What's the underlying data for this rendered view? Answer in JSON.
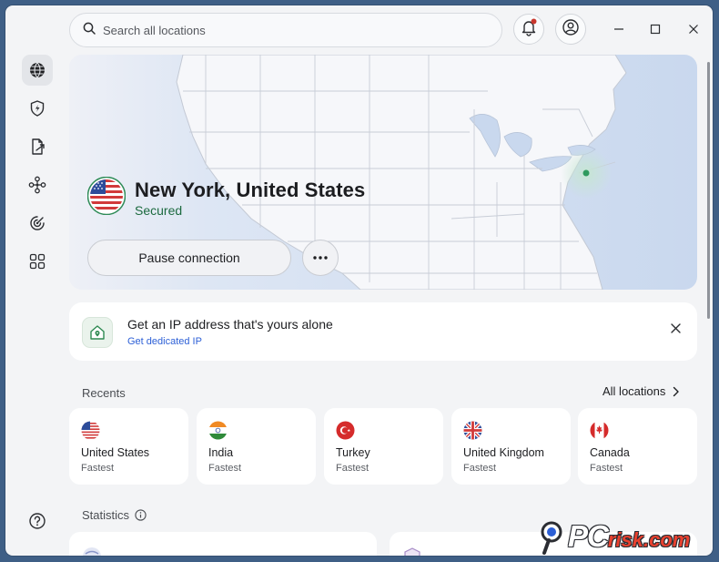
{
  "search": {
    "placeholder": "Search all locations"
  },
  "icons": {
    "search": "search-icon",
    "bell": "bell-icon",
    "account": "account-icon",
    "minimize": "minimize-icon",
    "maximize": "maximize-icon",
    "close": "close-icon",
    "sidebar": [
      "globe-icon",
      "shield-bolt-icon",
      "file-share-icon",
      "mesh-network-icon",
      "radar-icon",
      "apps-grid-icon"
    ],
    "help": "help-icon",
    "info": "info-icon",
    "chevron": "chevron-right-icon",
    "more": "more-horizontal-icon"
  },
  "connection": {
    "location": "New York, United States",
    "status": "Secured",
    "pause_label": "Pause connection"
  },
  "promo": {
    "title": "Get an IP address that's yours alone",
    "link": "Get dedicated IP"
  },
  "recents": {
    "label": "Recents",
    "all_label": "All locations",
    "items": [
      {
        "name": "United States",
        "sub": "Fastest",
        "flag": "us-flag-icon"
      },
      {
        "name": "India",
        "sub": "Fastest",
        "flag": "india-flag-icon"
      },
      {
        "name": "Turkey",
        "sub": "Fastest",
        "flag": "turkey-flag-icon"
      },
      {
        "name": "United Kingdom",
        "sub": "Fastest",
        "flag": "uk-flag-icon"
      },
      {
        "name": "Canada",
        "sub": "Fastest",
        "flag": "canada-flag-icon"
      }
    ]
  },
  "statistics": {
    "label": "Statistics"
  },
  "watermark": {
    "brand": "PC",
    "suffix": "risk.com"
  },
  "colors": {
    "accent": "#2c5fd6",
    "secured": "#1c6a3f",
    "notification": "#c8372d",
    "map_water": "#c9d8ee"
  }
}
